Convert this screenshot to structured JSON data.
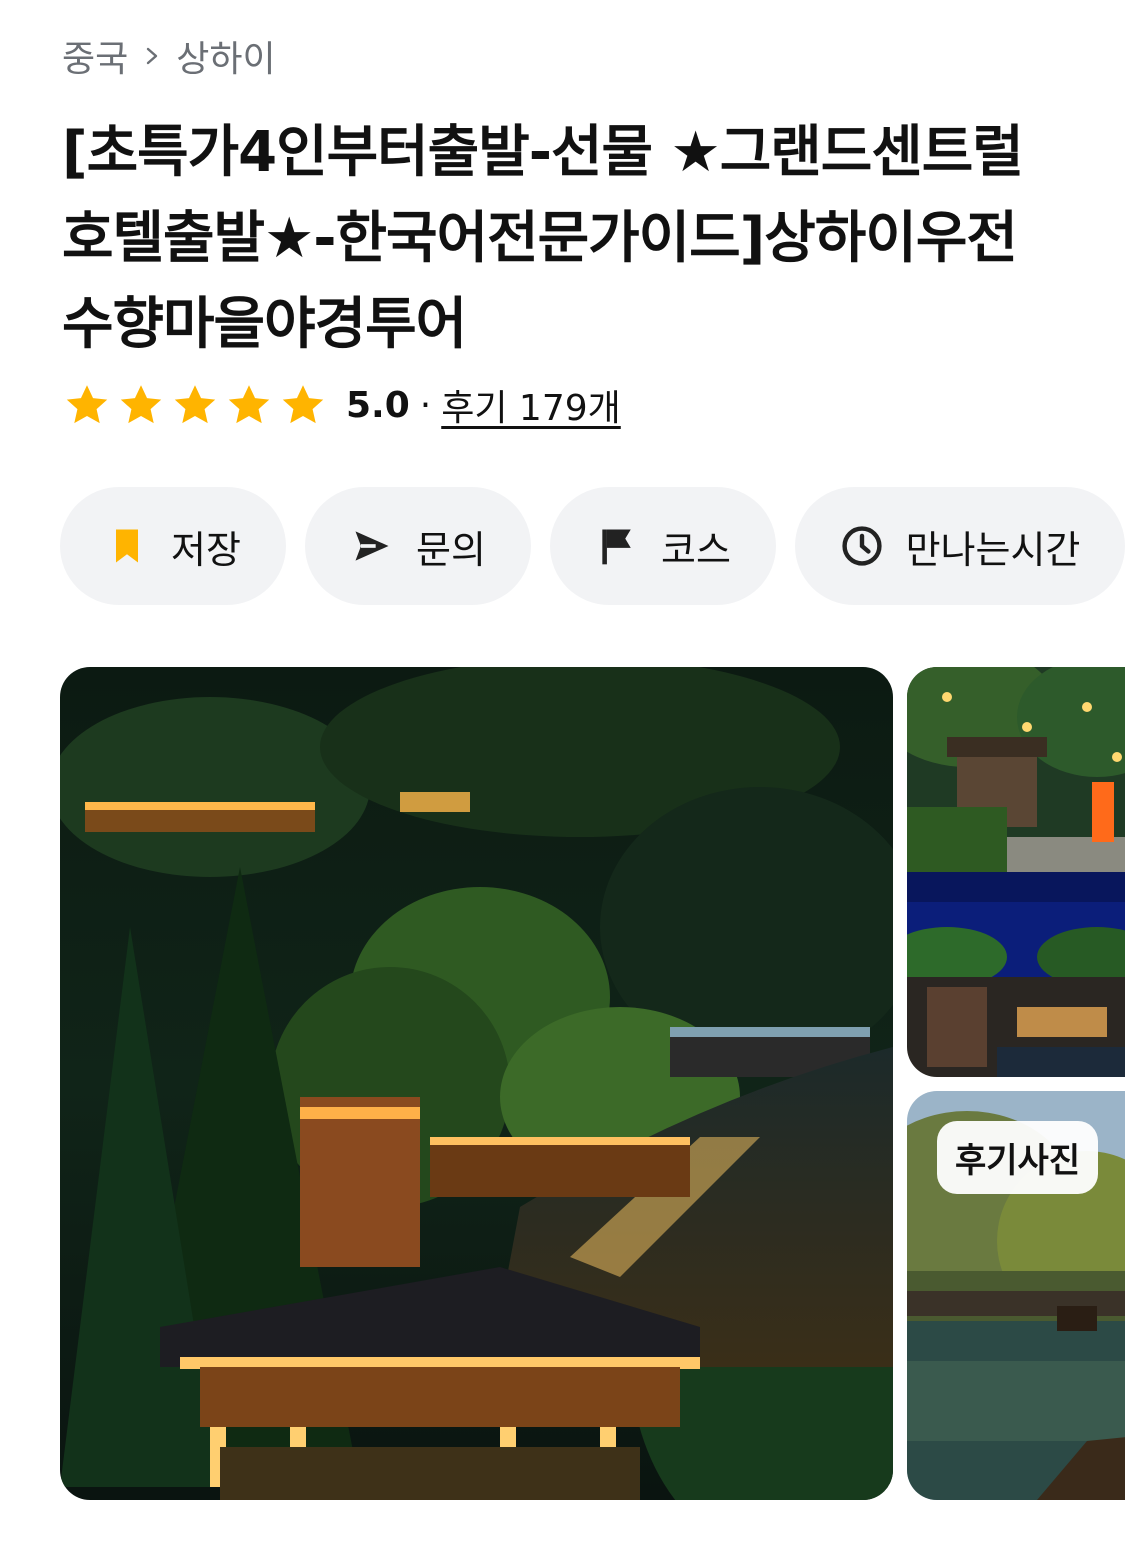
{
  "breadcrumb": {
    "country": "중국",
    "city": "상하이"
  },
  "title": "[초특가4인부터출발-선물 ★그랜드센트럴호텔출발★-한국어전문가이드]상하이우전수향마을야경투어",
  "rating": {
    "score": "5.0",
    "separator": "·",
    "reviews_label": "후기 179개",
    "stars": 5,
    "star_color": "#FFB400"
  },
  "actions": [
    {
      "label": "저장",
      "icon": "bookmark-icon"
    },
    {
      "label": "문의",
      "icon": "send-icon"
    },
    {
      "label": "코스",
      "icon": "flag-icon"
    },
    {
      "label": "만나는시간",
      "icon": "clock-icon"
    }
  ],
  "gallery": {
    "review_photo_badge": "후기사진"
  }
}
